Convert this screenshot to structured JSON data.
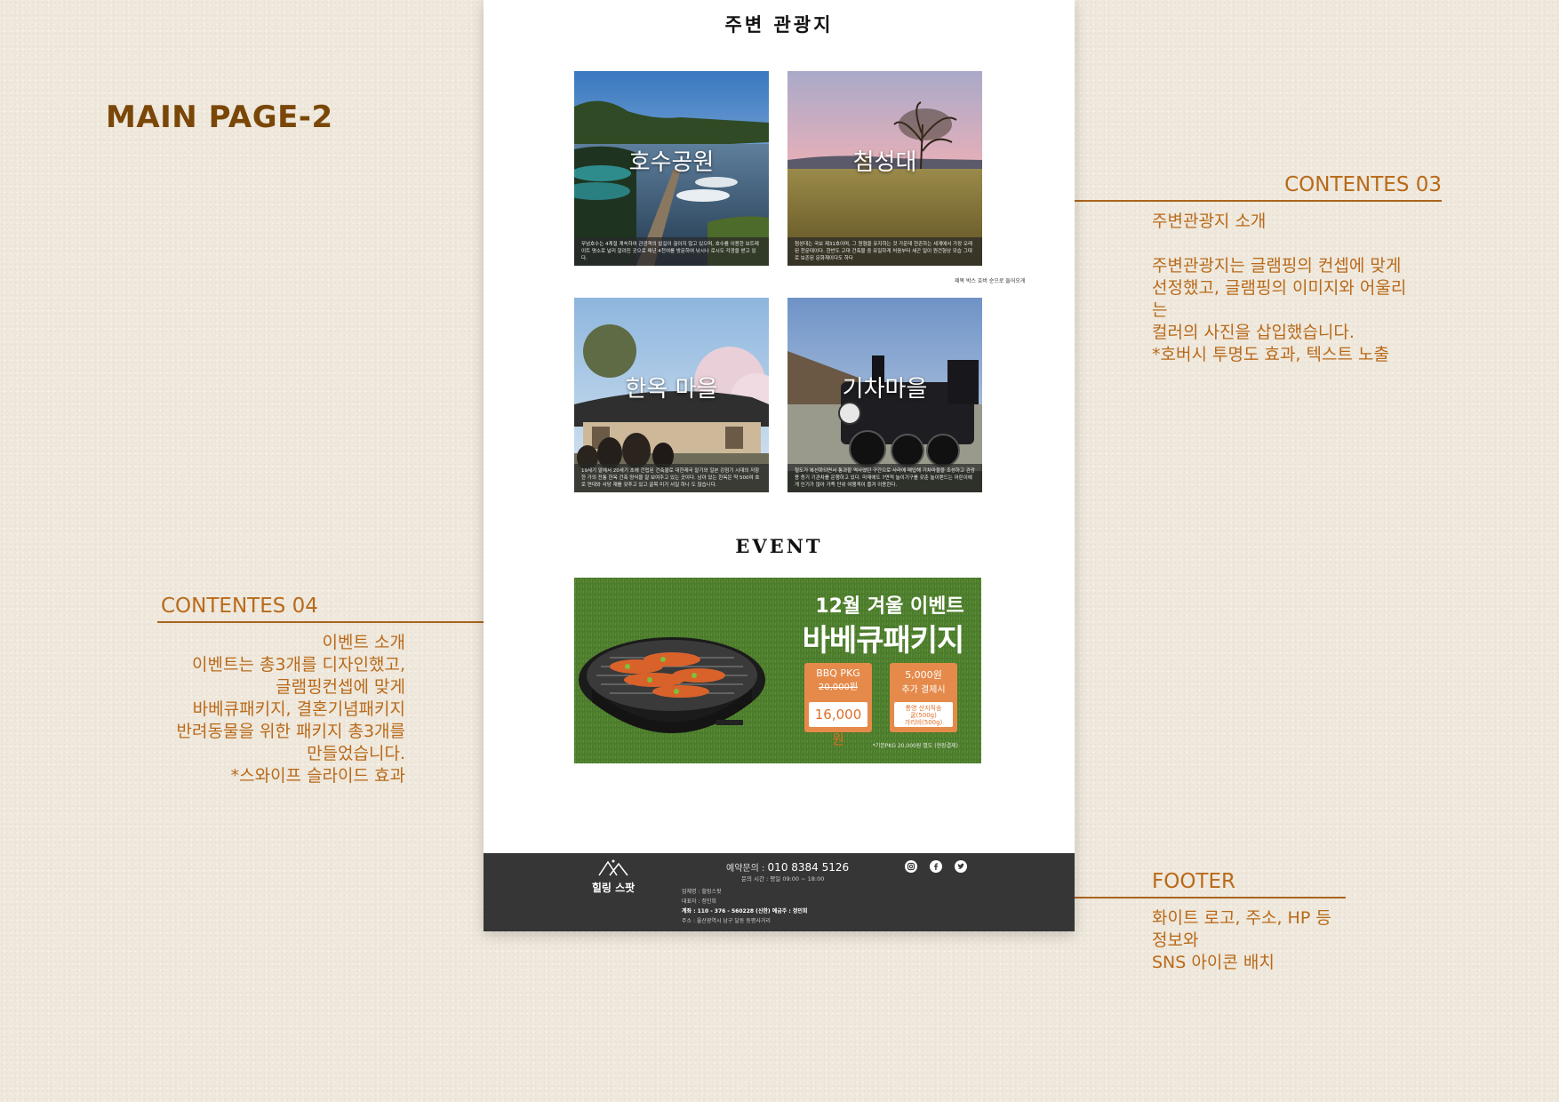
{
  "page_title": "MAIN PAGE-2",
  "annotations": {
    "contents03": {
      "heading": "CONTENTES 03",
      "body": "주변관광지 소개\n\n주변관광지는 글램핑의 컨셉에 맞게\n선정했고, 글램핑의 이미지와 어울리\n는\n컬러의 사진을 삽입했습니다.\n*호버시 투명도 효과, 텍스트 노출"
    },
    "contents04": {
      "heading": "CONTENTES 04",
      "body": "이벤트 소개\n이벤트는 총3개를 디자인했고,\n글램핑컨셉에 맞게\n바베큐패키지, 결혼기념패키지\n반려동물을 위한 패키지 총3개를\n만들었습니다.\n*스와이프 슬라이드 효과"
    },
    "footer": {
      "heading": "FOOTER",
      "body": "화이트 로고, 주소, HP 등 정보와\nSNS 아이콘 배치"
    }
  },
  "site": {
    "tour_title": "주변 관광지",
    "cards": [
      {
        "name": "호수공원",
        "desc": "무넘호수는 4계절 계속하여 관광객의 발길이 끊이지 않고 있으며, 호수를 이용한 보트레이트 명소로 널리 알려진 곳으로 매년 4천여를 방문하여 낚시나 로시도 각광을 받고 있다."
      },
      {
        "name": "첨성대",
        "desc": "첨성대는 국보 제31호이며, 그 원형을 유지하는 것 가운데 현존하는 세계에서 가장 오래된 천문대이다. 한반도 고대 건축물 중 유일하게 처음부터 세곤 일이 원건형상 모습 그대로 보존된 문화재이다도 하다"
      },
      {
        "name": "한옥 마을",
        "desc": "19세기 말에서 20세기 초에 건립된 건축물로 대한제국 말기와 일본 강점기 시대의 저항 한 가의 전통 한옥 건축 양식을 잘 보여주고 있는 곳이다. 남아 있는 한옥은 약 500여 호로 연대와 사당 재를 갖추고 있고 골목 미가 서일 하나 도 많습니다."
      },
      {
        "name": "기차마을",
        "desc": "철도가 복선화되면서 통과할 역사였던 구간으로 사라에 매입해 기차마을을 조성하고 관광용 증기 기관차를 운행하고 있다. 마재에도 7면적 놀이기구를 갖춘 놀이랜드는 어린이에게 인기가 많아 가족 단위 여행객이 즐겨 이용한다."
      }
    ],
    "card_note": "제목 박스 호버 순으로 들어오게",
    "event_title": "EVENT",
    "event": {
      "line1": "12월 겨울 이벤트",
      "line2": "바베큐패키지",
      "box1_label": "BBQ PKG",
      "box1_old": "20,000원",
      "box1_price": "16,000원",
      "box2_line1": "5,000원",
      "box2_line2": "추가 결제시",
      "box2_detail": "통영 산지직송\n굴(500g)\n가리비(500g)",
      "fine_print": "*기본PKG 20,000원 별도 (현장결제)"
    },
    "footer": {
      "logo_text": "힐링 스팟",
      "contact_label": "예약문의 :",
      "phone": "010 8384 5126",
      "hours": "문의 시간 : 평일 09:00 ~ 18:00",
      "info_lines": [
        "업체명 : 힐링스팟",
        "대표자 : 정민희"
      ],
      "account": "계좌 : 110 - 376 - 560228 (신한) 예금주 : 정민희",
      "address": "주소 : 울산광역시 남구 달동 동평사거리",
      "sns": [
        "instagram-icon",
        "facebook-icon",
        "twitter-icon"
      ]
    }
  }
}
